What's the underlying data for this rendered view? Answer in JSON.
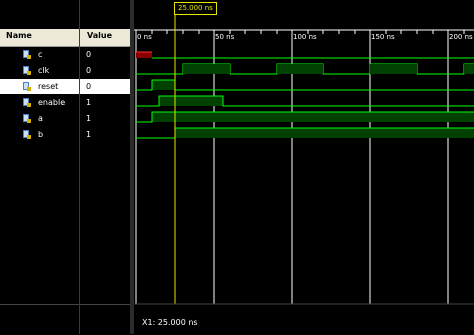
{
  "headers": {
    "name": "Name",
    "value": "Value"
  },
  "signals": [
    {
      "name": "c",
      "value": "0"
    },
    {
      "name": "clk",
      "value": "0"
    },
    {
      "name": "reset",
      "value": "0"
    },
    {
      "name": "enable",
      "value": "1"
    },
    {
      "name": "a",
      "value": "1"
    },
    {
      "name": "b",
      "value": "1"
    }
  ],
  "timeline": {
    "cursor_label": "25.000 ns",
    "ticks": [
      "0 ns",
      "50 ns",
      "100 ns",
      "150 ns",
      "200 ns"
    ]
  },
  "status": {
    "cursor_readout": "X1: 25.000 ns"
  },
  "colors": {
    "wave": "#00ff00",
    "cursor": "#e6e600",
    "unknown": "#ff3030",
    "fill": "#004000"
  }
}
